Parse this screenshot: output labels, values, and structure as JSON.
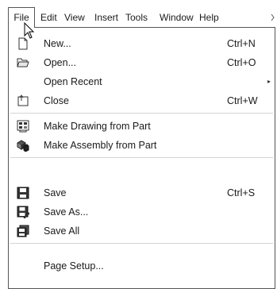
{
  "menubar": {
    "items": [
      {
        "label": "File",
        "active": true
      },
      {
        "label": "Edit"
      },
      {
        "label": "View"
      },
      {
        "label": "Insert"
      },
      {
        "label": "Tools"
      },
      {
        "label": "Window"
      },
      {
        "label": "Help"
      }
    ],
    "overflow_icon": "chevron-right-icon"
  },
  "file_menu": {
    "items": [
      {
        "label": "New...",
        "shortcut": "Ctrl+N",
        "icon": "new-document-icon"
      },
      {
        "label": "Open...",
        "shortcut": "Ctrl+O",
        "icon": "open-folder-icon"
      },
      {
        "label": "Open Recent",
        "has_submenu": true
      },
      {
        "label": "Close",
        "shortcut": "Ctrl+W",
        "icon": "close-document-icon"
      },
      {
        "label": "Make Drawing from Part",
        "icon": "drawing-from-part-icon"
      },
      {
        "label": "Make Assembly from Part",
        "icon": "assembly-from-part-icon"
      },
      {
        "label": "Save",
        "shortcut": "Ctrl+S",
        "icon": "save-icon"
      },
      {
        "label": "Save As...",
        "icon": "save-as-icon"
      },
      {
        "label": "Save All",
        "icon": "save-all-icon"
      },
      {
        "label": "Page Setup..."
      }
    ],
    "submenu_arrow": "▸"
  }
}
